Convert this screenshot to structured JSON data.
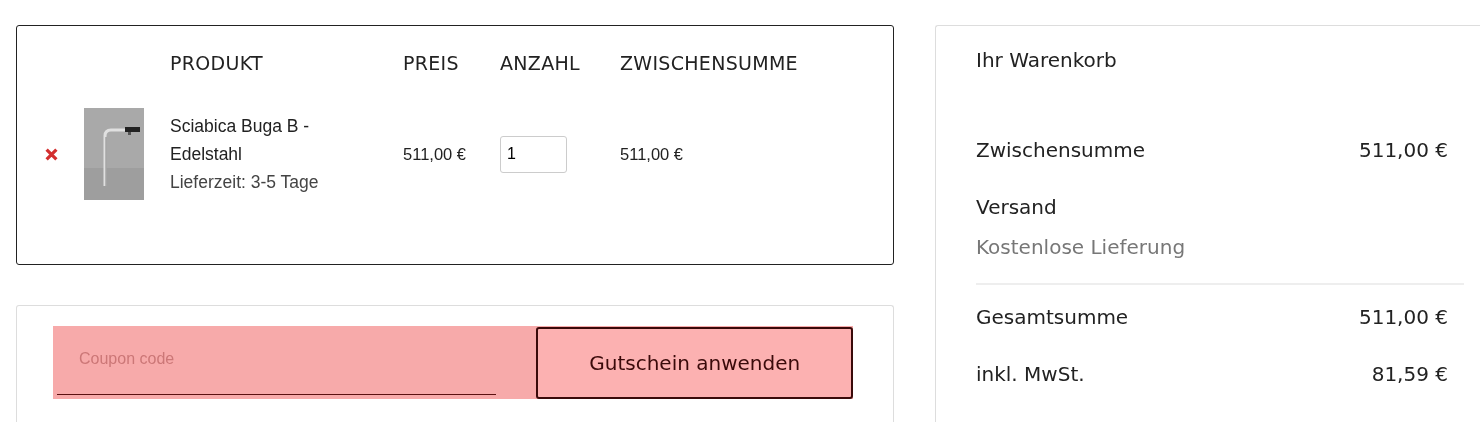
{
  "cart": {
    "columns": [
      {
        "label": "PRODUKT"
      },
      {
        "label": "PREIS"
      },
      {
        "label": "ANZAHL"
      },
      {
        "label": "ZWISCHENSUMME"
      }
    ],
    "items": [
      {
        "name": "Sciabica Buga B - Edelstahl",
        "delivery": "Lieferzeit: 3-5 Tage",
        "price": "511,00 €",
        "quantity": "1",
        "subtotal": "511,00 €"
      }
    ]
  },
  "coupon": {
    "placeholder": "Coupon code",
    "button": "Gutschein anwenden"
  },
  "summary": {
    "title": "Ihr Warenkorb",
    "rows": [
      {
        "kind": "amount",
        "label": "Zwischensumme",
        "value": "511,00 €"
      },
      {
        "kind": "shipping",
        "label": "Versand",
        "note": "Kostenlose Lieferung"
      },
      {
        "kind": "total",
        "label": "Gesamtsumme",
        "value": "511,00 €"
      },
      {
        "kind": "amount",
        "label": "inkl. MwSt.",
        "value": "81,59 €"
      }
    ]
  }
}
